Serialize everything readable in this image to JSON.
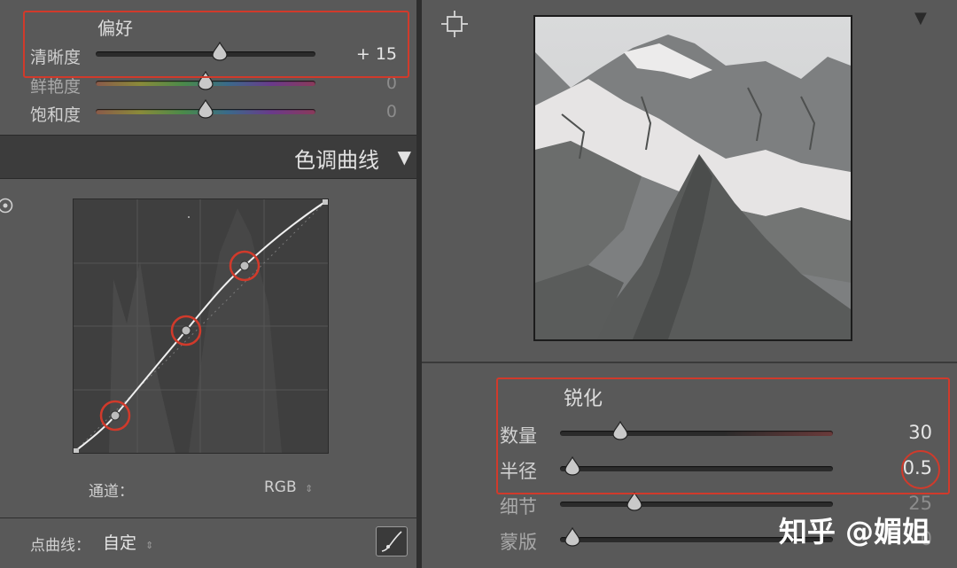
{
  "presence": {
    "title": "偏好",
    "sliders": [
      {
        "label": "清晰度",
        "value": "+ 15",
        "level": 0.7
      },
      {
        "label": "鲜艳度",
        "value": "0",
        "level": 0.5
      },
      {
        "label": "饱和度",
        "value": "0",
        "level": 0.5
      }
    ]
  },
  "tone_curve": {
    "title": "色调曲线",
    "channel_label": "通道：",
    "channel_value": "RGB",
    "point_curve_label": "点曲线：",
    "point_curve_value": "自定"
  },
  "sharpening": {
    "title": "锐化",
    "sliders": [
      {
        "label": "数量",
        "value": "30",
        "level": 0.22
      },
      {
        "label": "半径",
        "value": "0.5",
        "level": 0.0
      },
      {
        "label": "细节",
        "value": "25",
        "level": 0.25
      },
      {
        "label": "蒙版",
        "value": "0",
        "level": 0.0
      }
    ]
  },
  "watermark": "知乎 @媚姐",
  "colors": {
    "highlight": "#d13a2b",
    "panel": "#595959",
    "header": "#3c3c3c"
  },
  "icons": [
    "target-icon",
    "crosshair-icon",
    "dropdown-triangle-icon",
    "stepper-icon",
    "curve-icon"
  ]
}
